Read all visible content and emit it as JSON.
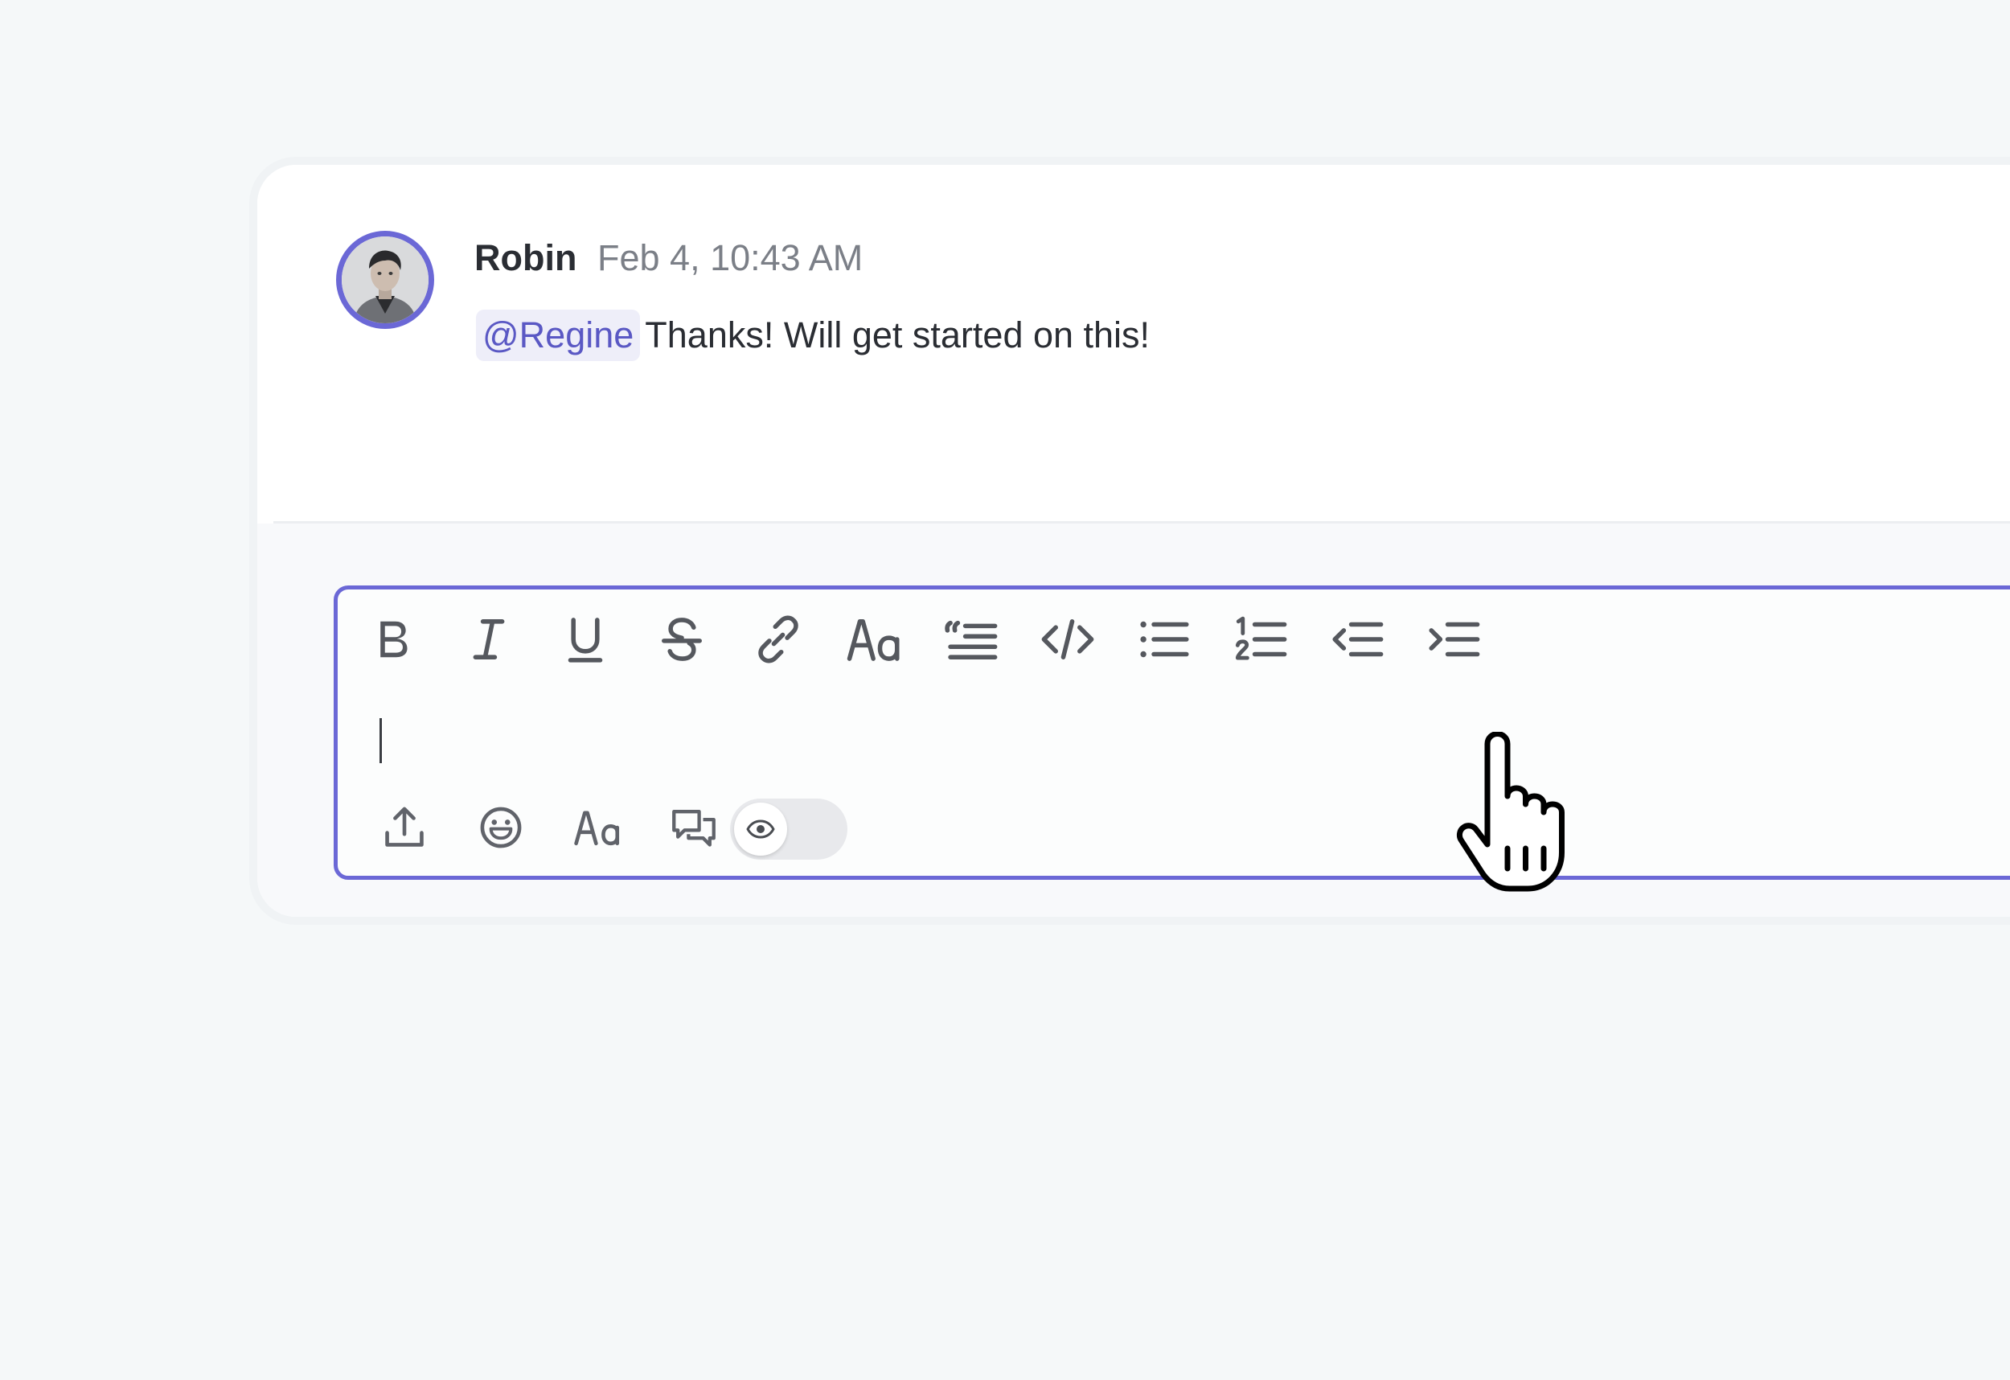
{
  "comment": {
    "author": "Robin",
    "timestamp": "Feb 4, 10:43 AM",
    "mention": "@Regine",
    "text": "Thanks! Will get started on this!"
  },
  "editor": {
    "toolbar": [
      {
        "name": "bold",
        "icon": "bold-icon"
      },
      {
        "name": "italic",
        "icon": "italic-icon"
      },
      {
        "name": "underline",
        "icon": "underline-icon"
      },
      {
        "name": "strikethrough",
        "icon": "strikethrough-icon"
      },
      {
        "name": "link",
        "icon": "link-icon"
      },
      {
        "name": "font",
        "icon": "font-size-icon",
        "label": "Aa"
      },
      {
        "name": "quote",
        "icon": "quote-icon"
      },
      {
        "name": "code",
        "icon": "code-icon"
      },
      {
        "name": "bulleted-list",
        "icon": "bulleted-list-icon"
      },
      {
        "name": "numbered-list",
        "icon": "numbered-list-icon",
        "label": "1 2"
      },
      {
        "name": "outdent",
        "icon": "outdent-icon"
      },
      {
        "name": "indent",
        "icon": "indent-icon"
      }
    ],
    "bottom_tools": [
      {
        "name": "upload",
        "icon": "upload-icon"
      },
      {
        "name": "emoji",
        "icon": "emoji-icon"
      },
      {
        "name": "formatting",
        "icon": "text-format-icon",
        "label": "Aa"
      },
      {
        "name": "comments",
        "icon": "chat-bubbles-icon"
      }
    ],
    "visibility_toggle": {
      "icon": "eye-icon",
      "on": false
    },
    "text_value": ""
  },
  "colors": {
    "accent": "#6b68d6",
    "mention_bg": "#eeeef9",
    "mention_text": "#5a58c4",
    "page_bg": "#f5f8f9"
  }
}
